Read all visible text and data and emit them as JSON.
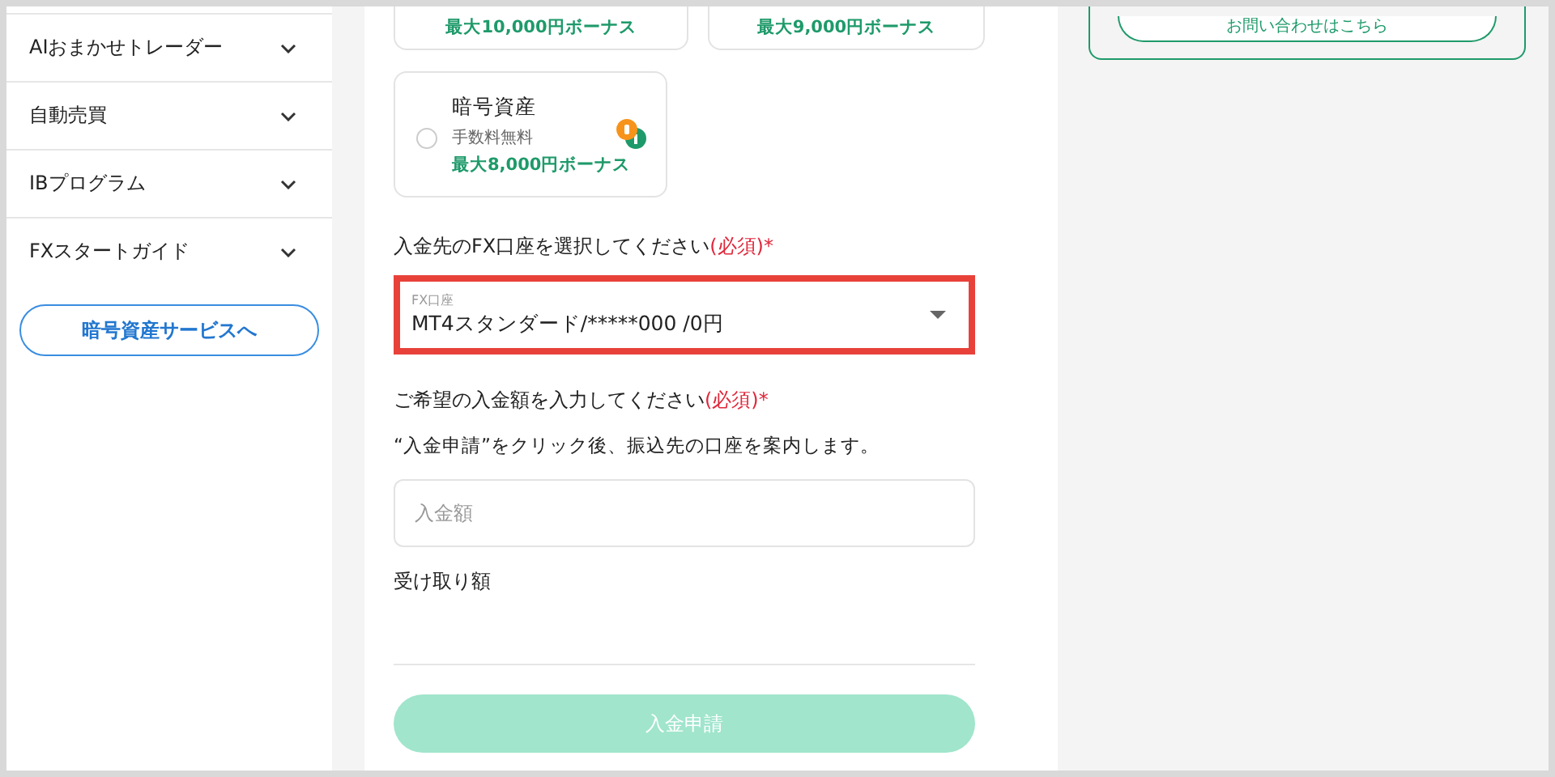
{
  "sidebar": {
    "items": [
      {
        "label": "AIおまかせトレーダー"
      },
      {
        "label": "自動売買"
      },
      {
        "label": "IBプログラム"
      },
      {
        "label": "FXスタートガイド"
      }
    ],
    "button": "暗号資産サービスへ"
  },
  "payment_methods": [
    {
      "bonus": "最大10,000円ボーナス"
    },
    {
      "bonus": "最大9,000円ボーナス"
    },
    {
      "title": "暗号資産",
      "fee": "手数料無料",
      "bonus": "最大8,000円ボーナス",
      "selected": false
    }
  ],
  "account_select": {
    "label": "入金先のFX口座を選択してください",
    "required": "(必須)*",
    "field_label": "FX口座",
    "value": "MT4スタンダード/*****000 /0円"
  },
  "amount": {
    "label": "ご希望の入金額を入力してください",
    "required": "(必須)*",
    "note": "“入金申請”をクリック後、振込先の口座を案内します。",
    "placeholder": "入金額"
  },
  "received": {
    "label": "受け取り額"
  },
  "submit": {
    "label": "入金申請",
    "disabled": true
  },
  "contact": {
    "button": "お問い合わせはこちら"
  }
}
